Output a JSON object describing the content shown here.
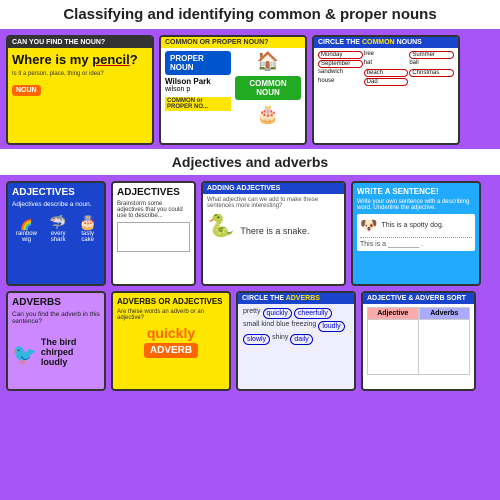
{
  "page": {
    "title": "Classifying and identifying common & proper nouns",
    "section1_label": "Adjectives and adverbs"
  },
  "nouns": {
    "card1": {
      "title": "CAN YOU FIND THE NOUN?",
      "question": "Where is my pencil?",
      "sub": "Is it a person, place, thing or idea?",
      "badge": "NOUN"
    },
    "card2": {
      "title": "COMMON or PROPER NOUN?",
      "proper_label": "PROPER NOUN",
      "location": "Wilson Park",
      "sub": "wilson p",
      "common_label": "COMMON NOUN",
      "common_title_bar": "COMMON or PROPER NO..."
    },
    "card3": {
      "title": "CIRCLE THE COMMON NOUNS",
      "words": [
        "Monday",
        "tree",
        "Summer",
        "September",
        "hat",
        "ball",
        "sandwich",
        "beach",
        "Christmas",
        "house",
        "Dad"
      ]
    }
  },
  "adjectives": {
    "card_adj1": {
      "title": "ADJECTIVES",
      "sub": "Adjectives describe a noun.",
      "images": [
        "rainbow-wig",
        "every shark",
        "tasty cake"
      ]
    },
    "card_adj2": {
      "title": "ADJECTIVES",
      "sub": "Brainstorm some adjectives that you could use to describe..."
    },
    "card_adding": {
      "title": "ADDING ADJECTIVES",
      "sub": "What adjective can we add to make these sentences more interesting?",
      "sentence": "There is a snake."
    },
    "card_write": {
      "title": "WRITE A SENTENCE!",
      "sub": "Write your own sentence with a describing word. Underline the adjective.",
      "example": "This is a spotty dog.",
      "blank_label": "This is a ________ ."
    },
    "card_adverbs": {
      "title": "ADVERBS",
      "sub": "Can you find the adverb in this sentence?",
      "sentence": "The bird chirped loudly"
    },
    "card_adverbs_or_adj": {
      "title": "ADVERBS or ADJECTIVES",
      "sub": "Are these words an adverb or an adjective?",
      "word": "quickly",
      "label": "ADVERB"
    },
    "card_circle_adverbs": {
      "title": "CIRCLE THE ADVERBS",
      "words": [
        {
          "text": "pretty",
          "circled": false
        },
        {
          "text": "quickly",
          "circled": true
        },
        {
          "text": "cheerfully",
          "circled": true
        },
        {
          "text": "small",
          "circled": false
        },
        {
          "text": "kind",
          "circled": false
        },
        {
          "text": "blue",
          "circled": false
        },
        {
          "text": "freezing",
          "circled": false
        },
        {
          "text": "loudly",
          "circled": true
        },
        {
          "text": "slowly",
          "circled": true
        },
        {
          "text": "shiny",
          "circled": false
        },
        {
          "text": "daily",
          "circled": true
        }
      ]
    },
    "card_sort": {
      "title": "ADJECTIVE & ADVERB SORT",
      "col1": "Adjective",
      "col2": "Adverbs"
    }
  }
}
